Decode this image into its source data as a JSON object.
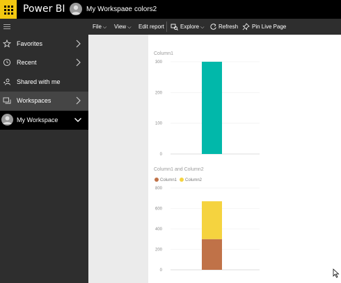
{
  "app": {
    "title": "Power BI"
  },
  "breadcrumb": {
    "workspace": "My Workspace",
    "separator": "›",
    "report": "colors2"
  },
  "nav": {
    "items": [
      {
        "label": "Favorites",
        "icon": "star-icon",
        "chevron": true
      },
      {
        "label": "Recent",
        "icon": "clock-icon",
        "chevron": true
      },
      {
        "label": "Shared with me",
        "icon": "shared-person-icon",
        "chevron": false
      },
      {
        "label": "Workspaces",
        "icon": "workspaces-icon",
        "chevron": true
      },
      {
        "label": "My Workspace",
        "icon": "avatar-icon",
        "chevron": "down"
      }
    ]
  },
  "toolbar": {
    "file": "File",
    "view": "View",
    "edit_report": "Edit report",
    "explore": "Explore",
    "refresh": "Refresh",
    "pin_live_page": "Pin Live Page"
  },
  "colors": {
    "brand": "#F2C811",
    "teal": "#01B8AA",
    "brown": "#C07248",
    "yellow": "#F5D33F"
  },
  "chart_data": [
    {
      "type": "bar",
      "title": "Column1",
      "categories": [
        ""
      ],
      "series": [
        {
          "name": "Column1",
          "values": [
            300
          ],
          "color": "#01B8AA"
        }
      ],
      "yticks": [
        0,
        100,
        200,
        300
      ],
      "ylim": [
        0,
        300
      ],
      "legend": "none"
    },
    {
      "type": "bar",
      "stacked": true,
      "title": "Column1 and Column2",
      "categories": [
        ""
      ],
      "series": [
        {
          "name": "Column1",
          "values": [
            300
          ],
          "color": "#C07248"
        },
        {
          "name": "Column2",
          "values": [
            370
          ],
          "color": "#F5D33F"
        }
      ],
      "yticks": [
        0,
        200,
        400,
        600,
        800
      ],
      "ylim": [
        0,
        800
      ],
      "legend": "top-left"
    }
  ]
}
